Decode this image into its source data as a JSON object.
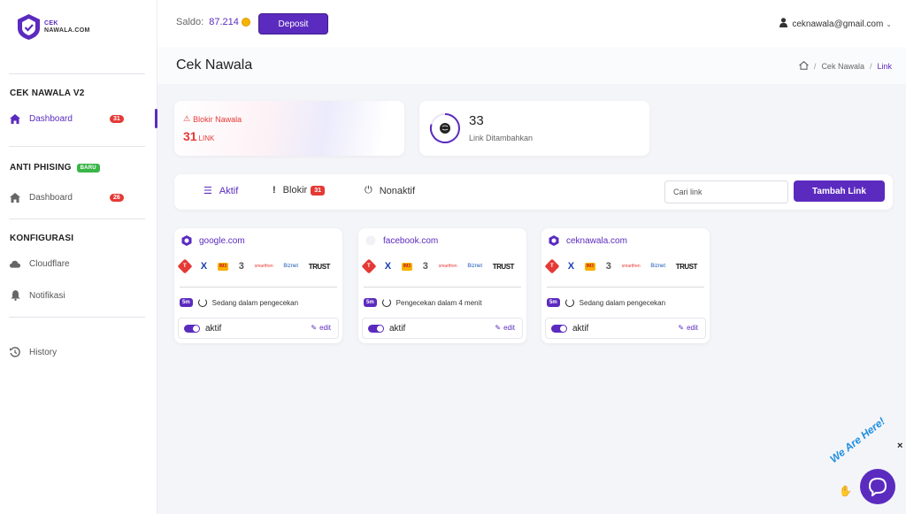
{
  "brand": {
    "line1": "CEK",
    "line2": "NAWALA.COM"
  },
  "sidebar": {
    "sections": [
      {
        "title": "CEK NAWALA V2"
      },
      {
        "title": "ANTI PHISING",
        "badge": "BARU"
      },
      {
        "title": "KONFIGURASI"
      }
    ],
    "items": [
      {
        "label": "Dashboard",
        "icon": "home-icon",
        "count": "31",
        "active": true
      },
      {
        "label": "Dashboard",
        "icon": "home-icon",
        "count": "26"
      },
      {
        "label": "Cloudflare",
        "icon": "cloud-icon"
      },
      {
        "label": "Notifikasi",
        "icon": "bell-icon"
      },
      {
        "label": "History",
        "icon": "history-icon"
      }
    ]
  },
  "topbar": {
    "saldo_label": "Saldo:",
    "saldo_value": "87.214",
    "deposit_label": "Deposit",
    "user_email": "ceknawala@gmail.com"
  },
  "page": {
    "title": "Cek Nawala",
    "breadcrumb": [
      "Cek Nawala",
      "Link"
    ]
  },
  "stats": {
    "blokir": {
      "label": "Blokir Nawala",
      "value": "31",
      "unit": "LINK"
    },
    "added": {
      "value": "33",
      "label": "Link Ditambahkan"
    }
  },
  "tabs": [
    {
      "label": "Aktif",
      "icon": "list-icon",
      "active": true
    },
    {
      "label": "Blokir",
      "icon": "exclamation-icon",
      "count": "31"
    },
    {
      "label": "Nonaktif",
      "icon": "power-icon"
    }
  ],
  "search": {
    "placeholder": "Cari link"
  },
  "add_button": "Tambah Link",
  "isp_logos": [
    "Telkomsel",
    "XL",
    "IM3",
    "3",
    "Smartfren",
    "Biznet",
    "TRUST"
  ],
  "isp_marks": {
    "telkomsel": "T",
    "xl": "X",
    "im3": "IM3",
    "tri": "3",
    "smartfren": "smartfren",
    "biznet": "Biznet",
    "trust": "TRUST"
  },
  "links": [
    {
      "domain": "google.com",
      "interval": "5m",
      "status": "Sedang dalam pengecekan",
      "toggle": "aktif",
      "edit": "edit"
    },
    {
      "domain": "facebook.com",
      "interval": "5m",
      "status": "Pengecekan dalam 4 menit",
      "toggle": "aktif",
      "edit": "edit"
    },
    {
      "domain": "ceknawala.com",
      "interval": "5m",
      "status": "Sedang dalam pengecekan",
      "toggle": "aktif",
      "edit": "edit"
    }
  ],
  "chat_widget": {
    "text": "We Are Here!",
    "close": "×"
  },
  "colors": {
    "accent": "#5b2bbf",
    "danger": "#e53935",
    "success": "#3bb54a"
  }
}
